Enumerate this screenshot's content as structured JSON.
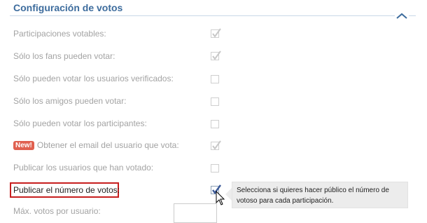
{
  "section": {
    "title": "Configuración de votos"
  },
  "settings": [
    {
      "label": "Participaciones votables:",
      "checked": true,
      "disabled": true
    },
    {
      "label": "Sólo los fans pueden votar:",
      "checked": true,
      "disabled": true
    },
    {
      "label": "Sólo pueden votar los usuarios verificados:",
      "checked": false,
      "disabled": true
    },
    {
      "label": "Sólo los amigos pueden votar:",
      "checked": false,
      "disabled": true
    },
    {
      "label": "Sólo pueden votar los participantes:",
      "checked": false,
      "disabled": true
    },
    {
      "label": "Obtener el email del usuario que vota:",
      "badge": "New!",
      "checked": true,
      "disabled": true
    },
    {
      "label": "Publicar los usuarios que han votado:",
      "checked": false,
      "disabled": true
    },
    {
      "label": "Publicar el número de votos:",
      "checked": true,
      "disabled": false,
      "highlighted": true
    }
  ],
  "max_votes": {
    "label": "Máx. votos por usuario:",
    "value": ""
  },
  "tooltip": {
    "text": "Selecciona si quieres hacer público el número de votoso para cada participación."
  },
  "colors": {
    "title": "#3d6c9d",
    "highlight_border": "#c71f1f",
    "badge": "#e0604f",
    "disabled_text": "#a3a3a3",
    "check_disabled": "#c8c8c8",
    "check_active": "#3b5998"
  }
}
